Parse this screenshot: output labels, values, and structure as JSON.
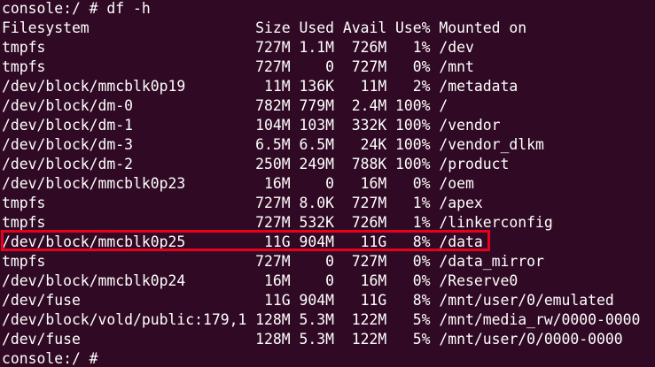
{
  "colors": {
    "background": "#300a24",
    "text": "#ffffff",
    "highlight": "#e8001c"
  },
  "terminal": {
    "lines": [
      "console:/ # df -h",
      "Filesystem                   Size Used Avail Use% Mounted on",
      "tmpfs                        727M 1.1M  726M   1% /dev",
      "tmpfs                        727M    0  727M   0% /mnt",
      "/dev/block/mmcblk0p19         11M 136K   11M   2% /metadata",
      "/dev/block/dm-0              782M 779M  2.4M 100% /",
      "/dev/block/dm-1              104M 103M  332K 100% /vendor",
      "/dev/block/dm-3              6.5M 6.5M   24K 100% /vendor_dlkm",
      "/dev/block/dm-2              250M 249M  788K 100% /product",
      "/dev/block/mmcblk0p23         16M    0   16M   0% /oem",
      "tmpfs                        727M 8.0K  727M   1% /apex",
      "tmpfs                        727M 532K  726M   1% /linkerconfig",
      "/dev/block/mmcblk0p25         11G 904M   11G   8% /data",
      "tmpfs                        727M    0  727M   0% /data_mirror",
      "/dev/block/mmcblk0p24         16M    0   16M   0% /Reserve0",
      "/dev/fuse                     11G 904M   11G   8% /mnt/user/0/emulated",
      "/dev/block/vold/public:179,1 128M 5.3M  122M   5% /mnt/media_rw/0000-0000",
      "/dev/fuse                    128M 5.3M  122M   5% /mnt/user/0/0000-0000",
      "console:/ # "
    ]
  }
}
